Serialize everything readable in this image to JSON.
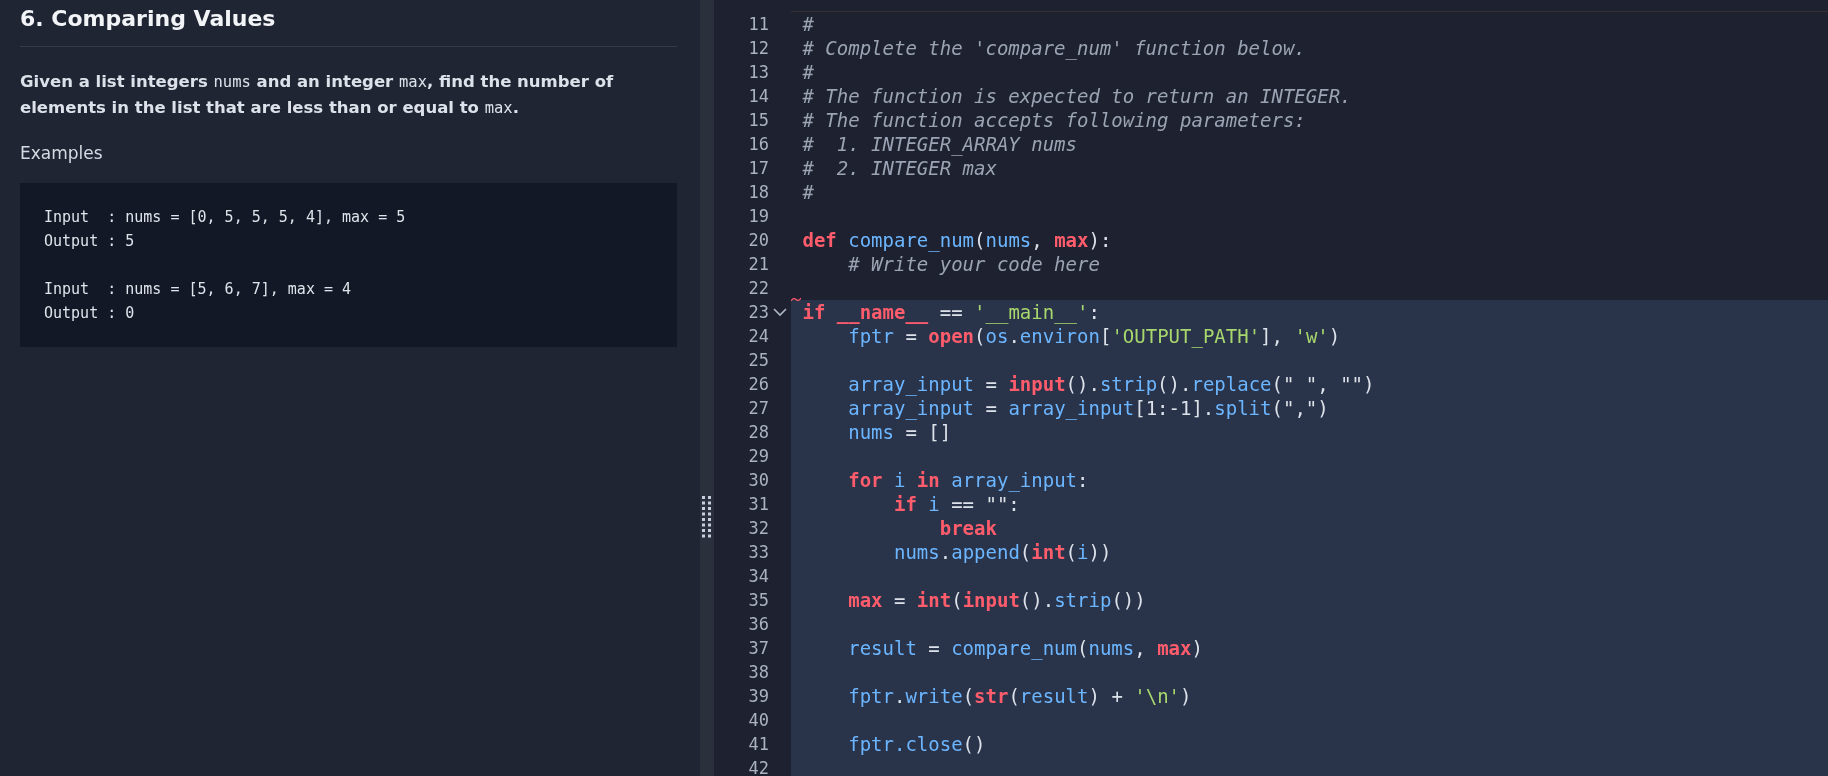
{
  "problem": {
    "title": "6. Comparing Values",
    "description": [
      {
        "kind": "text",
        "text": "Given a list integers "
      },
      {
        "kind": "code",
        "text": "nums"
      },
      {
        "kind": "text",
        "text": " and an integer "
      },
      {
        "kind": "code",
        "text": "max"
      },
      {
        "kind": "text",
        "text": ", find the number of elements in the list that are less than or equal to "
      },
      {
        "kind": "code",
        "text": "max"
      },
      {
        "kind": "text",
        "text": "."
      }
    ],
    "examples_label": "Examples",
    "examples": [
      "Input  : nums = [0, 5, 5, 5, 4], max = 5\nOutput : 5",
      "Input  : nums = [5, 6, 7], max = 4\nOutput : 0"
    ]
  },
  "editor": {
    "lines": [
      {
        "number": "11",
        "highlighted": false,
        "tokens": [
          {
            "kind": "comment",
            "text": "#"
          }
        ]
      },
      {
        "number": "12",
        "highlighted": false,
        "tokens": [
          {
            "kind": "comment",
            "text": "# Complete the 'compare_num' function below."
          }
        ]
      },
      {
        "number": "13",
        "highlighted": false,
        "tokens": [
          {
            "kind": "comment",
            "text": "#"
          }
        ]
      },
      {
        "number": "14",
        "highlighted": false,
        "tokens": [
          {
            "kind": "comment",
            "text": "# The function is expected to return an INTEGER."
          }
        ]
      },
      {
        "number": "15",
        "highlighted": false,
        "tokens": [
          {
            "kind": "comment",
            "text": "# The function accepts following parameters:"
          }
        ]
      },
      {
        "number": "16",
        "highlighted": false,
        "tokens": [
          {
            "kind": "comment",
            "text": "#  1. INTEGER_ARRAY nums"
          }
        ]
      },
      {
        "number": "17",
        "highlighted": false,
        "tokens": [
          {
            "kind": "comment",
            "text": "#  2. INTEGER max"
          }
        ]
      },
      {
        "number": "18",
        "highlighted": false,
        "tokens": [
          {
            "kind": "comment",
            "text": "#"
          }
        ]
      },
      {
        "number": "19",
        "highlighted": false
      },
      {
        "number": "20",
        "highlighted": false,
        "tokens": [
          {
            "kind": "keyword",
            "text": "def"
          },
          {
            "kind": "name",
            "text": " compare_num"
          },
          {
            "kind": "plain",
            "text": "("
          },
          {
            "kind": "name",
            "text": "nums"
          },
          {
            "kind": "plain",
            "text": ", "
          },
          {
            "kind": "keyword",
            "text": "max"
          },
          {
            "kind": "plain",
            "text": "):"
          }
        ]
      },
      {
        "number": "21",
        "highlighted": false,
        "tokens": [
          {
            "kind": "comment",
            "text": "    # Write your code here"
          }
        ]
      },
      {
        "number": "22",
        "highlighted": false
      },
      {
        "number": "23",
        "highlighted": true,
        "expanded": true,
        "error": true,
        "tokens": [
          {
            "kind": "keyword",
            "text": "if __name__"
          },
          {
            "kind": "plain",
            "text": " == "
          },
          {
            "kind": "string",
            "text": "'__main__'"
          },
          {
            "kind": "plain",
            "text": ":"
          }
        ]
      },
      {
        "number": "24",
        "highlighted": true,
        "tokens": [
          {
            "kind": "name",
            "text": "    fptr"
          },
          {
            "kind": "plain",
            "text": " = "
          },
          {
            "kind": "keyword",
            "text": "open"
          },
          {
            "kind": "plain",
            "text": "("
          },
          {
            "kind": "name",
            "text": "os"
          },
          {
            "kind": "plain",
            "text": "."
          },
          {
            "kind": "name",
            "text": "environ"
          },
          {
            "kind": "plain",
            "text": "["
          },
          {
            "kind": "string",
            "text": "'OUTPUT_PATH'"
          },
          {
            "kind": "plain",
            "text": "], "
          },
          {
            "kind": "string",
            "text": "'w'"
          },
          {
            "kind": "plain",
            "text": ")"
          }
        ]
      },
      {
        "number": "25",
        "highlighted": true
      },
      {
        "number": "26",
        "highlighted": true,
        "tokens": [
          {
            "kind": "name",
            "text": "    array_input"
          },
          {
            "kind": "plain",
            "text": " = "
          },
          {
            "kind": "keyword",
            "text": "input"
          },
          {
            "kind": "plain",
            "text": "()."
          },
          {
            "kind": "name",
            "text": "strip"
          },
          {
            "kind": "plain",
            "text": "()."
          },
          {
            "kind": "name",
            "text": "replace"
          },
          {
            "kind": "plain",
            "text": "(\" \", \"\")"
          }
        ]
      },
      {
        "number": "27",
        "highlighted": true,
        "tokens": [
          {
            "kind": "name",
            "text": "    array_input"
          },
          {
            "kind": "plain",
            "text": " = "
          },
          {
            "kind": "name",
            "text": "array_input"
          },
          {
            "kind": "plain",
            "text": "[1:-1]."
          },
          {
            "kind": "name",
            "text": "split"
          },
          {
            "kind": "plain",
            "text": "(\",\")"
          }
        ]
      },
      {
        "number": "28",
        "highlighted": true,
        "tokens": [
          {
            "kind": "name",
            "text": "    nums"
          },
          {
            "kind": "plain",
            "text": " = []"
          }
        ]
      },
      {
        "number": "29",
        "highlighted": true
      },
      {
        "number": "30",
        "highlighted": true,
        "tokens": [
          {
            "kind": "keyword",
            "text": "    for"
          },
          {
            "kind": "name",
            "text": " i"
          },
          {
            "kind": "keyword",
            "text": " in"
          },
          {
            "kind": "name",
            "text": " array_input"
          },
          {
            "kind": "plain",
            "text": ":"
          }
        ]
      },
      {
        "number": "31",
        "highlighted": true,
        "tokens": [
          {
            "kind": "keyword",
            "text": "        if"
          },
          {
            "kind": "name",
            "text": " i"
          },
          {
            "kind": "plain",
            "text": " == \"\":"
          }
        ]
      },
      {
        "number": "32",
        "highlighted": true,
        "tokens": [
          {
            "kind": "keyword",
            "text": "            break"
          }
        ]
      },
      {
        "number": "33",
        "highlighted": true,
        "tokens": [
          {
            "kind": "name",
            "text": "        nums"
          },
          {
            "kind": "plain",
            "text": "."
          },
          {
            "kind": "name",
            "text": "append"
          },
          {
            "kind": "plain",
            "text": "("
          },
          {
            "kind": "keyword",
            "text": "int"
          },
          {
            "kind": "plain",
            "text": "("
          },
          {
            "kind": "name",
            "text": "i"
          },
          {
            "kind": "plain",
            "text": "))"
          }
        ]
      },
      {
        "number": "34",
        "highlighted": true
      },
      {
        "number": "35",
        "highlighted": true,
        "tokens": [
          {
            "kind": "keyword",
            "text": "    max"
          },
          {
            "kind": "plain",
            "text": " = "
          },
          {
            "kind": "keyword",
            "text": "int"
          },
          {
            "kind": "plain",
            "text": "("
          },
          {
            "kind": "keyword",
            "text": "input"
          },
          {
            "kind": "plain",
            "text": "()."
          },
          {
            "kind": "name",
            "text": "strip"
          },
          {
            "kind": "plain",
            "text": "())"
          }
        ]
      },
      {
        "number": "36",
        "highlighted": true
      },
      {
        "number": "37",
        "highlighted": true,
        "tokens": [
          {
            "kind": "name",
            "text": "    result"
          },
          {
            "kind": "plain",
            "text": " = "
          },
          {
            "kind": "name",
            "text": "compare_num"
          },
          {
            "kind": "plain",
            "text": "("
          },
          {
            "kind": "name",
            "text": "nums"
          },
          {
            "kind": "plain",
            "text": ", "
          },
          {
            "kind": "keyword",
            "text": "max"
          },
          {
            "kind": "plain",
            "text": ")"
          }
        ]
      },
      {
        "number": "38",
        "highlighted": true
      },
      {
        "number": "39",
        "highlighted": true,
        "tokens": [
          {
            "kind": "name",
            "text": "    fptr"
          },
          {
            "kind": "plain",
            "text": "."
          },
          {
            "kind": "name",
            "text": "write"
          },
          {
            "kind": "plain",
            "text": "("
          },
          {
            "kind": "keyword",
            "text": "str"
          },
          {
            "kind": "plain",
            "text": "("
          },
          {
            "kind": "name",
            "text": "result"
          },
          {
            "kind": "plain",
            "text": ") + "
          },
          {
            "kind": "string",
            "text": "'\\n'"
          },
          {
            "kind": "plain",
            "text": ")"
          }
        ]
      },
      {
        "number": "40",
        "highlighted": true
      },
      {
        "number": "41",
        "highlighted": true,
        "tokens": [
          {
            "kind": "name",
            "text": "    fptr.close"
          },
          {
            "kind": "plain",
            "text": "()"
          }
        ]
      },
      {
        "number": "42",
        "highlighted": true
      }
    ]
  }
}
